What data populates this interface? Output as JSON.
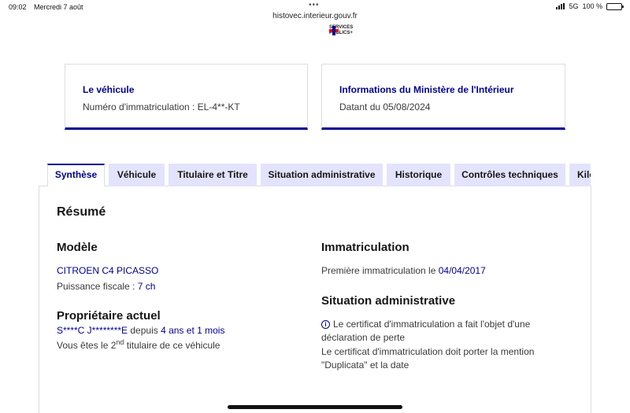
{
  "statusbar": {
    "time": "09:02",
    "date": "Mercredi 7 août",
    "network": "5G",
    "battery": "100 %"
  },
  "browser": {
    "url": "histovec.interieur.gouv.fr"
  },
  "brand": {
    "line1": "SERVICES",
    "line2": "PUBLICS+"
  },
  "cards": {
    "vehicle": {
      "title": "Le véhicule",
      "text": "Numéro d'immatriculation : EL-4**-KT"
    },
    "ministry": {
      "title": "Informations du Ministère de l'Intérieur",
      "text": "Datant du 05/08/2024"
    }
  },
  "tabs": [
    "Synthèse",
    "Véhicule",
    "Titulaire et Titre",
    "Situation administrative",
    "Historique",
    "Contrôles techniques",
    "Kilo"
  ],
  "summary": {
    "title": "Résumé",
    "model": {
      "heading": "Modèle",
      "name": "CITROEN C4 PICASSO",
      "power_label": "Puissance fiscale : ",
      "power_value": "7 ch"
    },
    "owner": {
      "heading": "Propriétaire actuel",
      "name": "S****C J********E",
      "since_label": " depuis ",
      "since_value": "4 ans et 1 mois",
      "rank_prefix": "Vous êtes le 2",
      "rank_sup": "nd",
      "rank_suffix": " titulaire de ce véhicule"
    },
    "registration": {
      "heading": "Immatriculation",
      "first_label": "Première immatriculation le ",
      "first_date": "04/04/2017"
    },
    "admin": {
      "heading": "Situation administrative",
      "icon": "i",
      "line1": "Le certificat d'immatriculation a fait l'objet d'une",
      "line2": "déclaration de perte",
      "line3": "Le certificat d'immatriculation doit porter la mention",
      "line4": "\"Duplicata\" et la date"
    }
  }
}
